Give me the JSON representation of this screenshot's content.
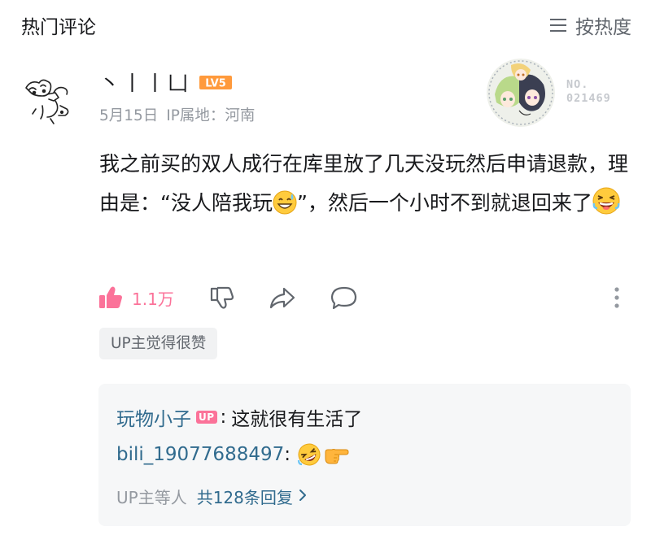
{
  "header": {
    "title": "热门评论",
    "sort_label": "按热度",
    "sort_icon": "menu-lines-icon"
  },
  "comment": {
    "username": "丶丨丨凵",
    "level": "LV5",
    "date": "5月15日",
    "ip_location": "IP属地：河南",
    "fan_number": "NO.\n021469",
    "text_part1": "我之前买的双人成行在库里放了几天没玩然后申请退款，理由是：“没人陪我玩",
    "text_part2": "”，然后一个小时不到就退回来了",
    "emoji_1": "sweat-smile-emoji",
    "emoji_2": "laughing-emoji",
    "like_count": "1.1万",
    "up_liked_tag": "UP主觉得很赞",
    "colors": {
      "like_pink": "#fb7299",
      "link_blue": "#316b8e",
      "meta_gray": "#9499a0"
    }
  },
  "replies": [
    {
      "user": "玩物小子",
      "is_up": true,
      "up_badge": "UP",
      "separator": ":",
      "text": "这就很有生活了"
    },
    {
      "user": "bili_19077688497",
      "is_up": false,
      "separator": ":",
      "emojis": [
        "rolling-laugh-emoji",
        "pointing-right-emoji"
      ]
    }
  ],
  "reply_summary": {
    "others": "UP主等人",
    "total": "共128条回复"
  }
}
